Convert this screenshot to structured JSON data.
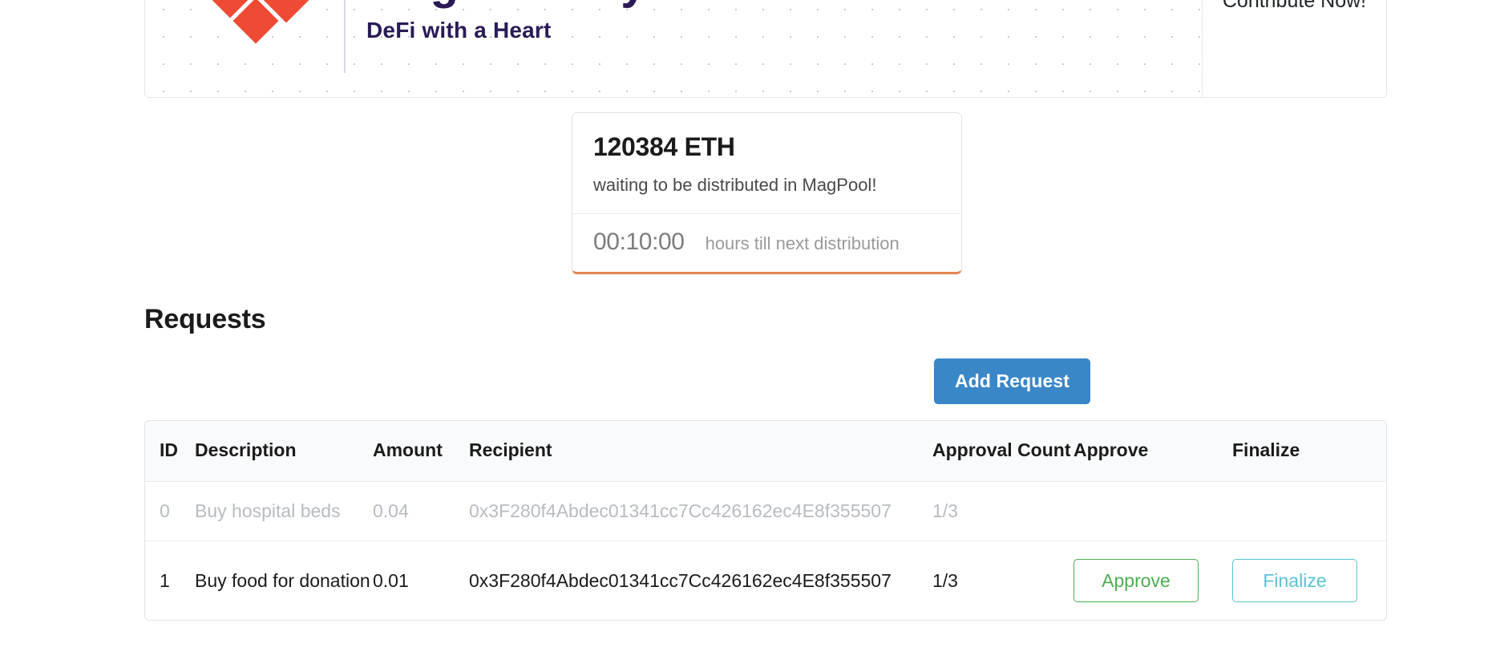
{
  "banner": {
    "logo_title": "Magnanimity",
    "logo_subtitle": "DeFi with a Heart",
    "contribute_label": "Contribute Now!",
    "colors": {
      "logo_red": "#ef4b34",
      "logo_blue": "#4a53a0",
      "logo_text": "#2b1a56"
    }
  },
  "pool": {
    "amount": "120384 ETH",
    "caption": "waiting to be distributed in MagPool!",
    "timer": "00:10:00",
    "timer_label": "hours till next distribution",
    "accent_color": "#e2854f"
  },
  "requests": {
    "heading": "Requests",
    "add_button_label": "Add Request",
    "add_button_color": "#3a87c8",
    "columns": [
      "ID",
      "Description",
      "Amount",
      "Recipient",
      "Approval Count",
      "Approve",
      "Finalize"
    ],
    "rows": [
      {
        "id": "0",
        "description": "Buy hospital beds",
        "amount": "0.04",
        "recipient": "0x3F280f4Abdec01341cc7Cc426162ec4E8f355507",
        "approval_count": "1/3",
        "approve_label": "",
        "finalize_label": "",
        "muted": true
      },
      {
        "id": "1",
        "description": "Buy food for donation",
        "amount": "0.01",
        "recipient": "0x3F280f4Abdec01341cc7Cc426162ec4E8f355507",
        "approval_count": "1/3",
        "approve_label": "Approve",
        "finalize_label": "Finalize",
        "muted": false
      }
    ],
    "approve_color": "#4caf50",
    "finalize_color": "#5bc2d4"
  }
}
